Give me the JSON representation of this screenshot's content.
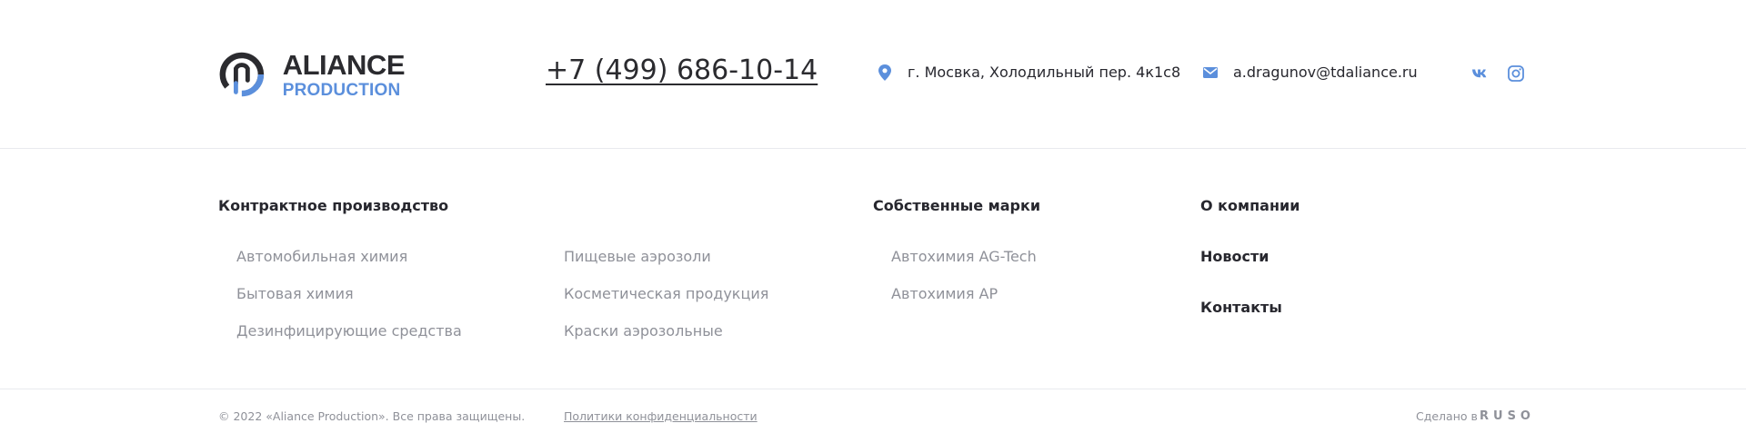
{
  "header": {
    "logo": {
      "line1": "ALIANCE",
      "line2": "PRODUCTION"
    },
    "phone": "+7 (499) 686-10-14",
    "address": "г. Мосвка, Холодильный пер. 4к1с8",
    "email": "a.dragunov@tdaliance.ru",
    "social": [
      {
        "name": "vk",
        "icon": "vk-icon"
      },
      {
        "name": "instagram",
        "icon": "instagram-icon"
      }
    ]
  },
  "columns": {
    "contract": {
      "title": "Контрактное производство",
      "left": [
        "Автомобильная химия",
        "Бытовая химия",
        "Дезинфицирующие средства"
      ],
      "right": [
        "Пищевые аэрозоли",
        "Косметическая продукция",
        "Краски аэрозольные"
      ]
    },
    "brands": {
      "title": "Собственные марки",
      "items": [
        "Автохимия AG-Tech",
        "Автохимия AP"
      ]
    },
    "company": {
      "title": "О компании",
      "items": [
        "Новости",
        "Контакты"
      ]
    }
  },
  "footer": {
    "copyright": "© 2022 «Aliance Production». Все права защищены.",
    "policy": "Политики конфиденциальности",
    "made_by_label": "Сделано в",
    "made_by_brand": "RUSO"
  },
  "colors": {
    "accent": "#5b8fdc",
    "text": "#27272e",
    "muted": "#8f9199",
    "divider": "#e9eaee"
  }
}
